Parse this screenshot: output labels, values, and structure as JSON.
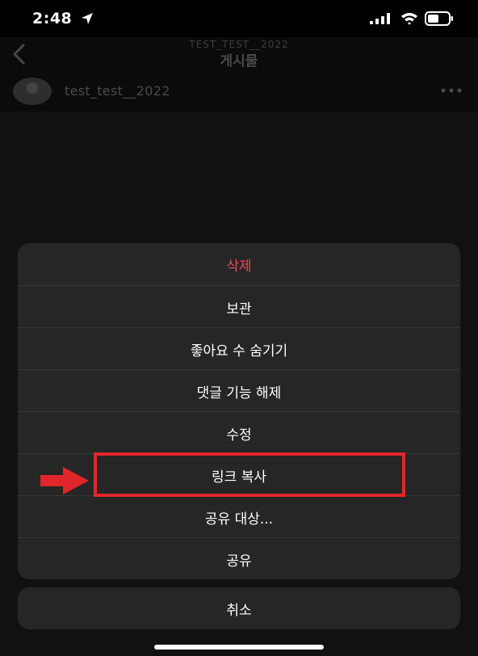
{
  "status_bar": {
    "time": "2:48"
  },
  "nav": {
    "subtitle": "TEST_TEST__2022",
    "title": "게시물"
  },
  "post": {
    "username": "test_test__2022"
  },
  "action_sheet": {
    "items": [
      {
        "label": "삭제",
        "style": "destructive"
      },
      {
        "label": "보관"
      },
      {
        "label": "좋아요 수 숨기기"
      },
      {
        "label": "댓글 기능 해제"
      },
      {
        "label": "수정"
      },
      {
        "label": "링크 복사",
        "highlighted": true
      },
      {
        "label": "공유 대상..."
      },
      {
        "label": "공유"
      }
    ],
    "cancel_label": "취소"
  },
  "colors": {
    "destructive": "#ed4956",
    "sheet_background": "#262626",
    "annotation": "#e0262b"
  },
  "icons": {
    "back": "chevron-left-icon",
    "more": "more-horizontal-icon",
    "location": "location-arrow-icon",
    "signal": "cellular-signal-icon",
    "wifi": "wifi-icon",
    "battery": "battery-icon",
    "annotation_arrow": "red-arrow-icon"
  }
}
